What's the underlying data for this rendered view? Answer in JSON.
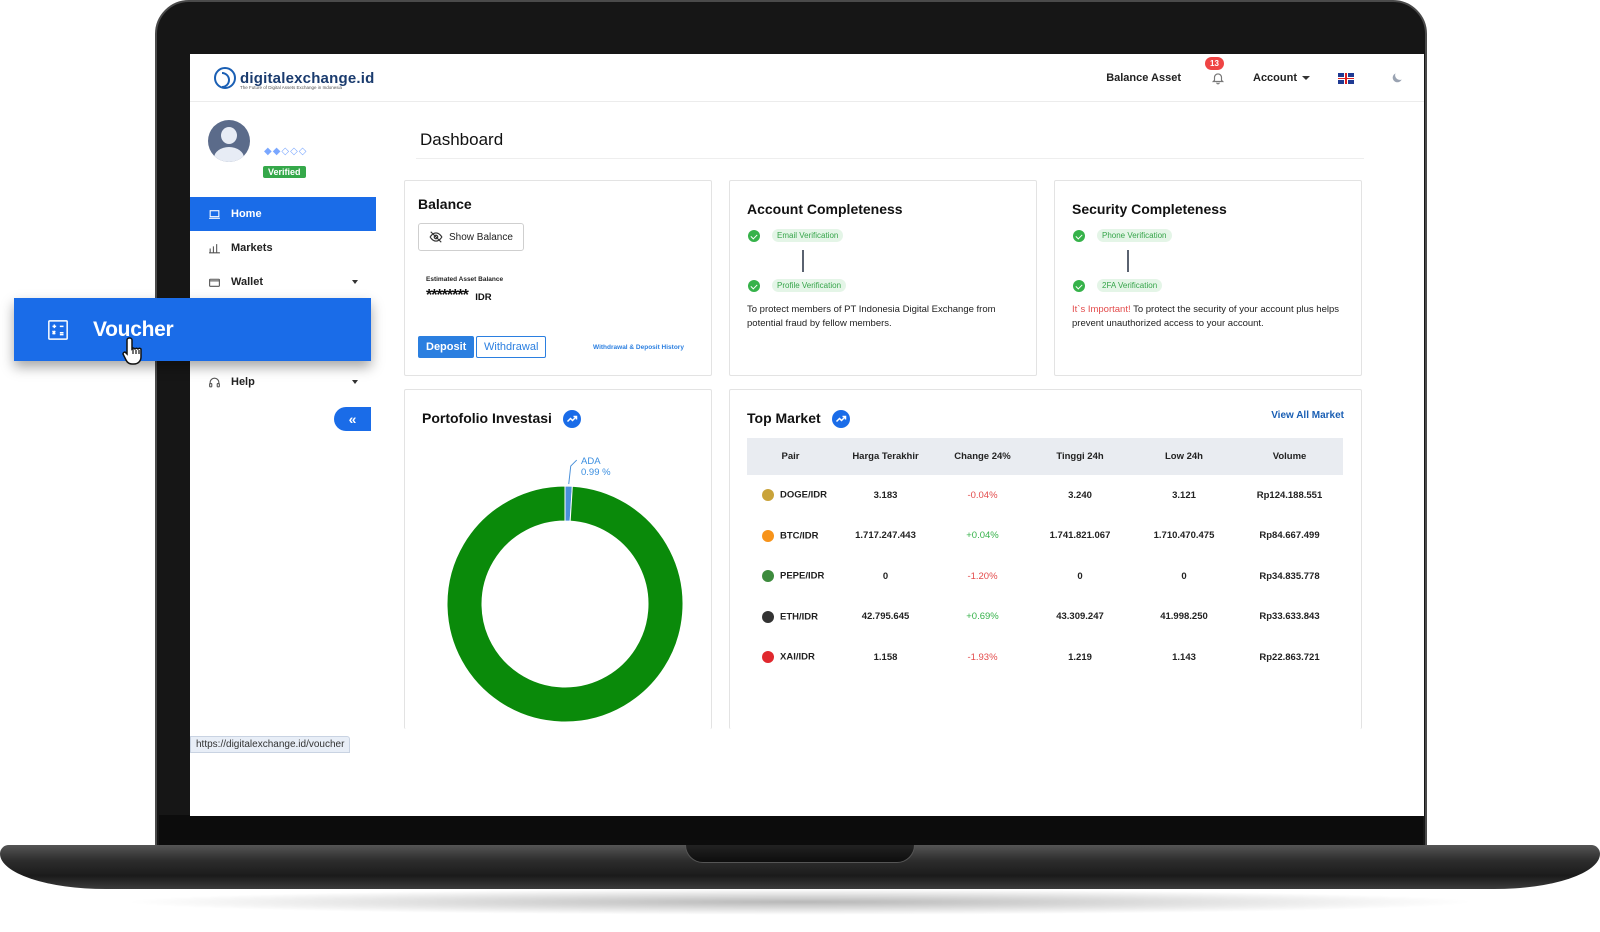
{
  "header": {
    "logo_text": "digitalexchange.id",
    "logo_subtitle": "The Future of Digital Assets Exchange in Indonesia",
    "balance_asset": "Balance Asset",
    "notification_count": "13",
    "account": "Account"
  },
  "sidebar": {
    "verified": "Verified",
    "gems": "◆◆◇◇◇",
    "items": [
      {
        "label": "Home"
      },
      {
        "label": "Markets"
      },
      {
        "label": "Wallet"
      },
      {
        "label": "Voucher"
      },
      {
        "label": "Help"
      }
    ],
    "collapse_label": "«",
    "status_url": "https://digitalexchange.id/voucher"
  },
  "page": {
    "title": "Dashboard"
  },
  "balance": {
    "title": "Balance",
    "show_balance": "Show Balance",
    "estimated_label": "Estimated Asset Balance",
    "masked_value": "********",
    "currency": "IDR",
    "deposit": "Deposit",
    "withdrawal": "Withdrawal",
    "history_link": "Withdrawal & Deposit History"
  },
  "account_completeness": {
    "title": "Account Completeness",
    "step1": "Email Verification",
    "step2": "Profile Verification",
    "description": "To protect members of PT Indonesia Digital Exchange from potential fraud by fellow members."
  },
  "security_completeness": {
    "title": "Security Completeness",
    "step1": "Phone Verification",
    "step2": "2FA Verification",
    "important": "It`s Important!",
    "description": " To protect the security of your account plus helps prevent unauthorized access to your account."
  },
  "portfolio": {
    "title": "Portofolio Investasi",
    "label_name": "ADA",
    "label_pct": "0.99 %",
    "colors": {
      "main": "#0a8a0a",
      "slice": "#4a90d9"
    }
  },
  "chart_data": {
    "type": "pie",
    "title": "Portofolio Investasi",
    "donut": true,
    "categories": [
      "ADA",
      ""
    ],
    "values": [
      0.99,
      99.01
    ]
  },
  "top_market": {
    "title": "Top Market",
    "view_all": "View All Market",
    "columns": [
      "Pair",
      "Harga Terakhir",
      "Change 24%",
      "Tinggi 24h",
      "Low 24h",
      "Volume"
    ],
    "rows": [
      {
        "pair": "DOGE/IDR",
        "price": "3.183",
        "change": "-0.04%",
        "high": "3.240",
        "low": "3.121",
        "volume": "Rp124.188.551",
        "icon": "doge-icon",
        "color": "#c9a33a"
      },
      {
        "pair": "BTC/IDR",
        "price": "1.717.247.443",
        "change": "+0.04%",
        "high": "1.741.821.067",
        "low": "1.710.470.475",
        "volume": "Rp84.667.499",
        "icon": "btc-icon",
        "color": "#f7931a"
      },
      {
        "pair": "PEPE/IDR",
        "price": "0",
        "change": "-1.20%",
        "high": "0",
        "low": "0",
        "volume": "Rp34.835.778",
        "icon": "pepe-icon",
        "color": "#3d8b3d"
      },
      {
        "pair": "ETH/IDR",
        "price": "42.795.645",
        "change": "+0.69%",
        "high": "43.309.247",
        "low": "41.998.250",
        "volume": "Rp33.633.843",
        "icon": "eth-icon",
        "color": "#333333"
      },
      {
        "pair": "XAI/IDR",
        "price": "1.158",
        "change": "-1.93%",
        "high": "1.219",
        "low": "1.143",
        "volume": "Rp22.863.721",
        "icon": "xai-icon",
        "color": "#e0282e"
      }
    ]
  },
  "colors": {
    "primary": "#1a6ce8",
    "positive": "#36b24a",
    "negative": "#e34b4b"
  }
}
